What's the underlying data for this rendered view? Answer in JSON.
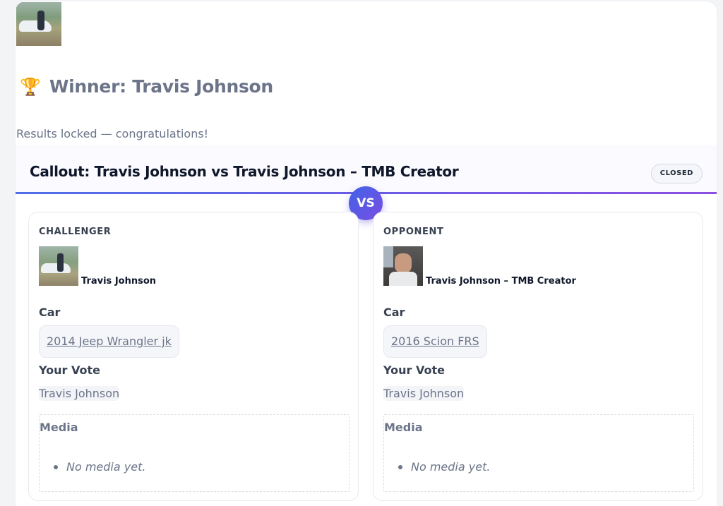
{
  "winner": {
    "trophy_icon": "trophy-icon",
    "title": "Winner: Travis Johnson",
    "subtitle": "Results locked — congratulations!"
  },
  "callout": {
    "title": "Callout: Travis Johnson vs Travis Johnson – TMB Creator",
    "status": "CLOSED",
    "vs_label": "VS"
  },
  "challenger": {
    "label": "CHALLENGER",
    "name": "Travis Johnson",
    "car_heading": "Car",
    "car": "2014 Jeep Wrangler jk",
    "vote_heading": "Your Vote",
    "vote": "Travis Johnson",
    "media_heading": "Media",
    "media_empty": "No media yet."
  },
  "opponent": {
    "label": "OPPONENT",
    "name": "Travis Johnson – TMB Creator",
    "car_heading": "Car",
    "car": "2016 Scion FRS",
    "vote_heading": "Your Vote",
    "vote": "Travis Johnson",
    "media_heading": "Media",
    "media_empty": "No media yet."
  },
  "colors": {
    "accent_start": "#4f6fe8",
    "accent_end": "#8b4fe0",
    "muted_text": "#6b7488"
  }
}
